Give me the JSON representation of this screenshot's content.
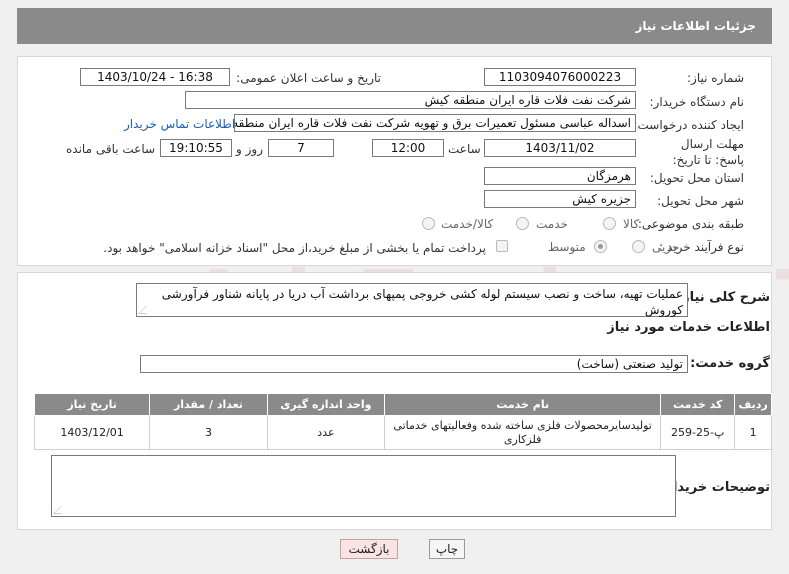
{
  "header": {
    "title": "جزئیات اطلاعات نیاز"
  },
  "fields": {
    "need_number_label": "شماره نیاز:",
    "need_number": "1103094076000223",
    "announce_datetime_label": "تاریخ و ساعت اعلان عمومی:",
    "announce_datetime": "1403/10/24 - 16:38",
    "buyer_org_label": "نام دستگاه خریدار:",
    "buyer_org": "شرکت نفت فلات قاره ایران منطقه کیش",
    "requester_label": "ایجاد کننده درخواست:",
    "requester": "اسداله  عباسی  مسئول تعمیرات برق و تهویه  شرکت نفت فلات قاره ایران منطقه کیش",
    "buyer_contact_link": "اطلاعات تماس خریدار",
    "deadline_label": "مهلت ارسال پاسخ: تا تاریخ:",
    "deadline_date": "1403/11/02",
    "time_label": "ساعت",
    "deadline_time": "12:00",
    "days_value": "7",
    "days_label": "روز و",
    "remaining_time": "19:10:55",
    "remaining_label": "ساعت باقی مانده",
    "province_label": "استان محل تحویل:",
    "province": "هرمزگان",
    "city_label": "شهر محل تحویل:",
    "city": "جزیره کیش",
    "category_label": "طبقه بندی موضوعی:",
    "category_options": [
      "کالا",
      "خدمت",
      "کالا/خدمت"
    ],
    "process_label": "نوع فرآیند خرید :",
    "process_options": [
      "جزیی",
      "متوسط"
    ],
    "payment_note": "پرداخت تمام یا بخشی از مبلغ خرید،از محل \"اسناد خزانه اسلامی\" خواهد بود."
  },
  "summary": {
    "label": "شرح کلی نیاز:",
    "text": "عملیات  تهیه، ساخت و نصب سیستم لوله کشی خروجی پمپهای برداشت آب دریا در پایانه شناور فرآورشی کوروش"
  },
  "services": {
    "section_title": "اطلاعات خدمات مورد نیاز",
    "group_label": "گروه خدمت:",
    "group_value": "تولید صنعتی (ساخت)",
    "columns": [
      "ردیف",
      "کد خدمت",
      "نام خدمت",
      "واحد اندازه گیری",
      "تعداد / مقدار",
      "تاریخ نیاز"
    ],
    "rows": [
      [
        "1",
        "پ-25-259",
        "تولیدسایرمحصولات فلزی ساخته شده وفعالیتهای خدماتی فلزکاری",
        "عدد",
        "3",
        "1403/12/01"
      ]
    ]
  },
  "buyer_notes_label": "توضیحات خریدار:",
  "buttons": {
    "print": "چاپ",
    "back": "بازگشت"
  },
  "watermark": "AriaTender.neT"
}
